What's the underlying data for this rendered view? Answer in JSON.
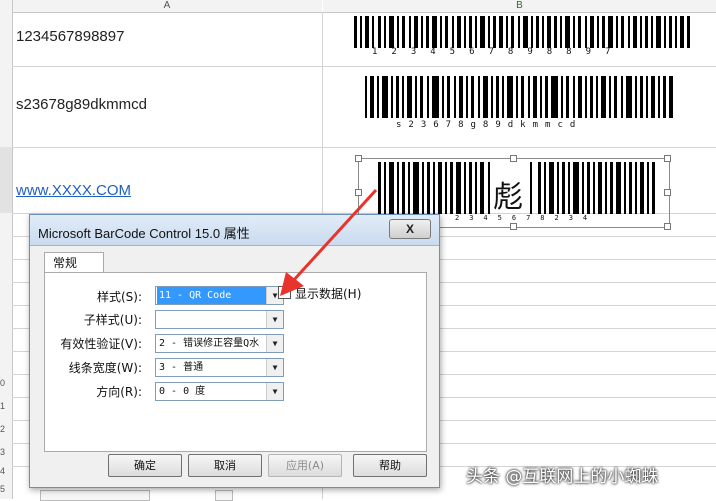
{
  "spreadsheet": {
    "col_a": "A",
    "col_b": "B",
    "cell_a1": "1234567898897",
    "cell_a2": "s23678g89dkmmcd",
    "cell_a3": "www.XXXX.COM",
    "barcode1_caption": "1234567898897",
    "barcode2_caption": "s23678g89dkmmcd",
    "barcode3_caption": "2345678234",
    "barcode3_glyph": "彪",
    "row_numbers": [
      "0",
      "1",
      "2",
      "3",
      "4",
      "5"
    ]
  },
  "dialog": {
    "title": "Microsoft BarCode Control 15.0 属性",
    "close_label": "X",
    "tab_general": "常规",
    "style_label": "样式(S):",
    "style_value": "11 - QR Code",
    "substyle_label": "子样式(U):",
    "substyle_value": "",
    "validation_label": "有效性验证(V):",
    "validation_value": "2 - 错误修正容量Q水",
    "linewidth_label": "线条宽度(W):",
    "linewidth_value": "3 - 普通",
    "direction_label": "方向(R):",
    "direction_value": "0 - 0 度",
    "show_data_label": "显示数据(H)",
    "show_data_checked": "✔",
    "ok_label": "确定",
    "cancel_label": "取消",
    "apply_label": "应用(A)",
    "help_label": "帮助"
  },
  "watermark": "头条 @互联网上的小蜘蛛",
  "colors": {
    "arrow": "#e8342c",
    "selection": "#3399ff",
    "link": "#1f5fbf"
  }
}
